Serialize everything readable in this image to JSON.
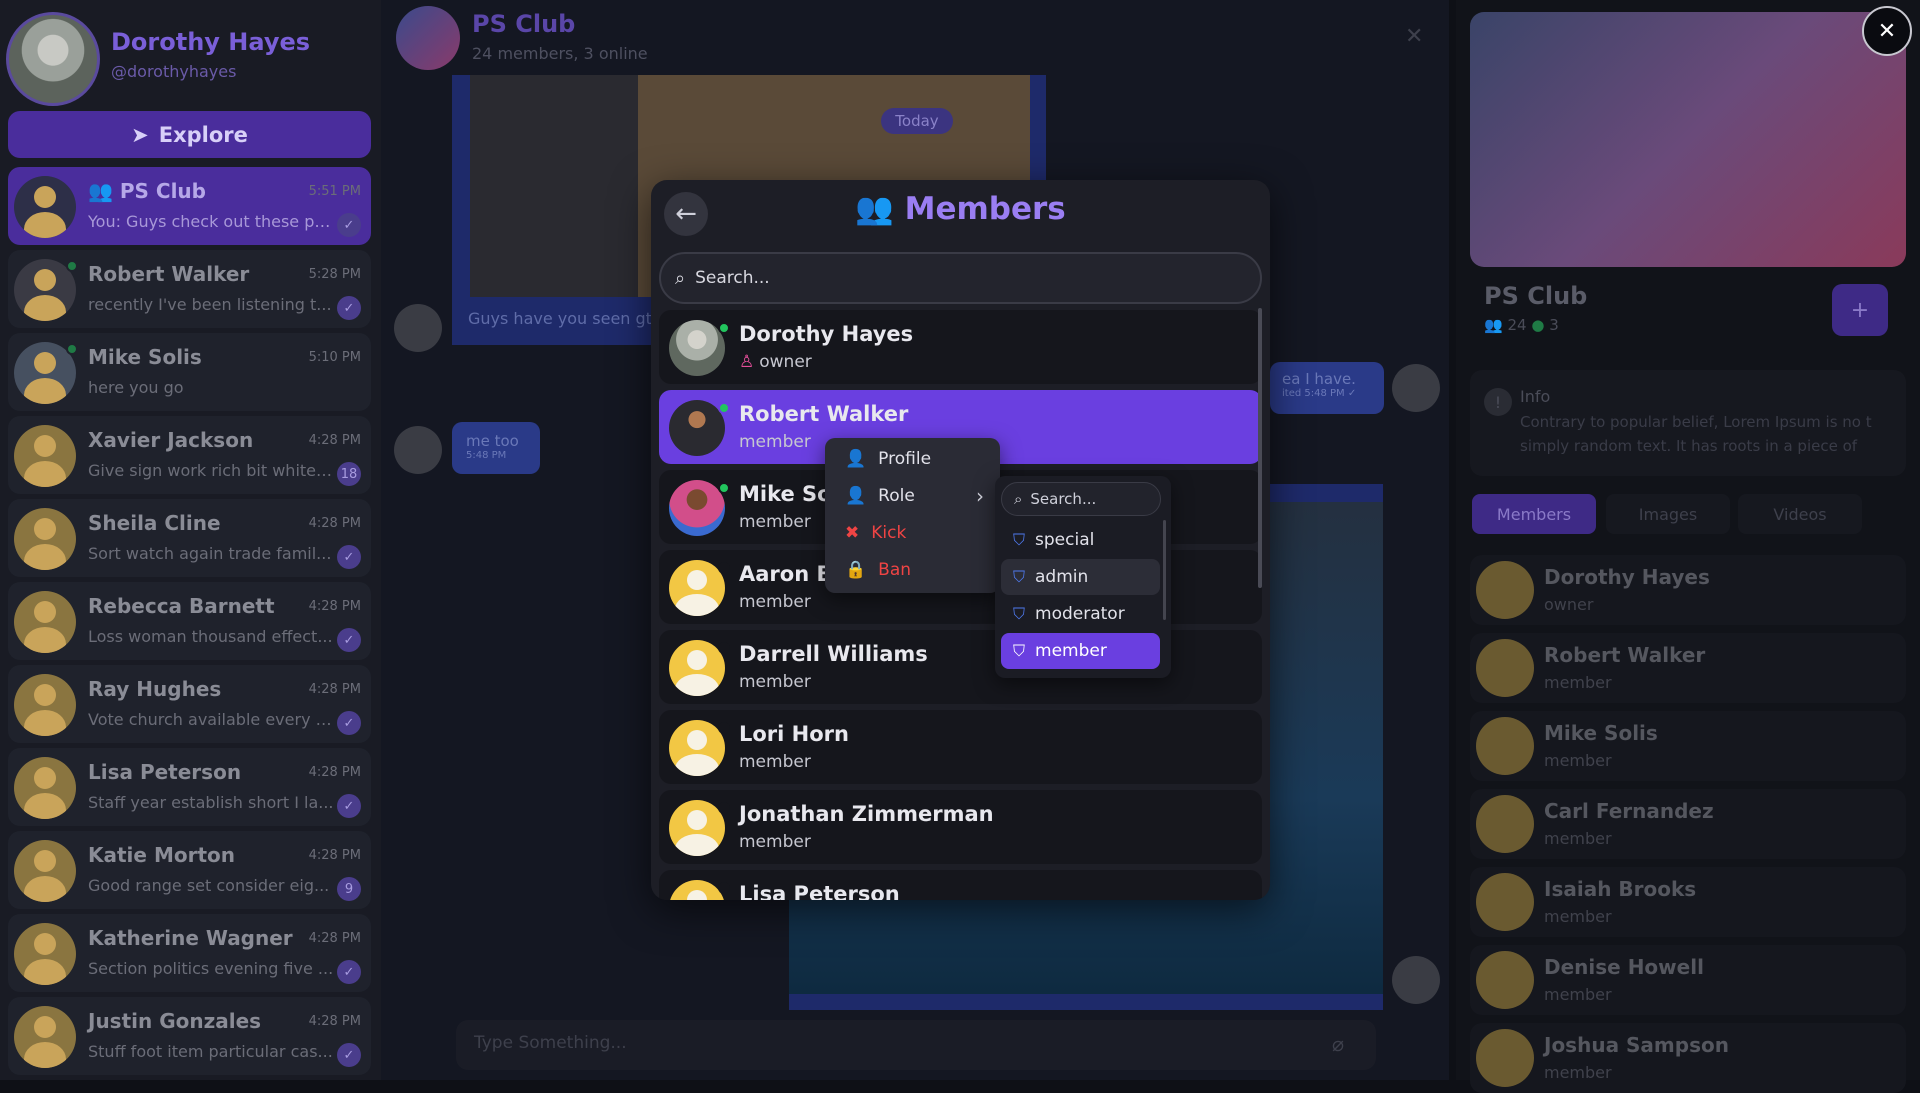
{
  "user": {
    "name": "Dorothy Hayes",
    "handle": "@dorothyhayes"
  },
  "explore_label": "Explore",
  "chats": [
    {
      "name": "PS Club",
      "time": "5:51 PM",
      "msg": "You: Guys check out these pc...",
      "badge": "✓",
      "group": true
    },
    {
      "name": "Robert Walker",
      "time": "5:28 PM",
      "msg": "recently I've been listening t...",
      "badge": "✓"
    },
    {
      "name": "Mike Solis",
      "time": "5:10 PM",
      "msg": "here you go",
      "badge": ""
    },
    {
      "name": "Xavier Jackson",
      "time": "4:28 PM",
      "msg": "Give sign work rich bit white ...",
      "badge": "18"
    },
    {
      "name": "Sheila Cline",
      "time": "4:28 PM",
      "msg": "Sort watch again trade famil...",
      "badge": "✓"
    },
    {
      "name": "Rebecca Barnett",
      "time": "4:28 PM",
      "msg": "Loss woman thousand effect...",
      "badge": "✓"
    },
    {
      "name": "Ray Hughes",
      "time": "4:28 PM",
      "msg": "Vote church available every t...",
      "badge": "✓"
    },
    {
      "name": "Lisa Peterson",
      "time": "4:28 PM",
      "msg": "Staff year establish short I la...",
      "badge": "✓"
    },
    {
      "name": "Katie Morton",
      "time": "4:28 PM",
      "msg": "Good range set consider eig...",
      "badge": "9"
    },
    {
      "name": "Katherine Wagner",
      "time": "4:28 PM",
      "msg": "Section politics evening five ...",
      "badge": "✓"
    },
    {
      "name": "Justin Gonzales",
      "time": "4:28 PM",
      "msg": "Stuff foot item particular cas...",
      "badge": "✓"
    }
  ],
  "channel": {
    "title": "PS Club",
    "subtitle": "24 members, 3 online",
    "today": "Today",
    "media_caption": "Guys have you seen gt",
    "me_too": "me too",
    "me_too_time": "5:48 PM",
    "i_have": "ea I have.",
    "i_have_time": "ited 5:48 PM ✓",
    "compose_placeholder": "Type Something..."
  },
  "group_panel": {
    "name": "PS Club",
    "members_count": "24",
    "online_count": "3",
    "info_title": "Info",
    "info_text": "Contrary to popular belief, Lorem Ipsum is no t simply random text. It has roots in a piece of",
    "tabs": [
      "Members",
      "Images",
      "Videos"
    ],
    "members": [
      {
        "name": "Dorothy Hayes",
        "role": "owner"
      },
      {
        "name": "Robert Walker",
        "role": "member"
      },
      {
        "name": "Mike Solis",
        "role": "member"
      },
      {
        "name": "Carl Fernandez",
        "role": "member"
      },
      {
        "name": "Isaiah Brooks",
        "role": "member"
      },
      {
        "name": "Denise Howell",
        "role": "member"
      },
      {
        "name": "Joshua Sampson",
        "role": "member"
      }
    ]
  },
  "modal": {
    "title": "Members",
    "search_placeholder": "Search...",
    "members": [
      {
        "name": "Dorothy Hayes",
        "role": "owner"
      },
      {
        "name": "Robert Walker",
        "role": "member"
      },
      {
        "name": "Mike Sol",
        "role": "member"
      },
      {
        "name": "Aaron Ba",
        "role": "member"
      },
      {
        "name": "Darrell Williams",
        "role": "member"
      },
      {
        "name": "Lori Horn",
        "role": "member"
      },
      {
        "name": "Jonathan Zimmerman",
        "role": "member"
      },
      {
        "name": "Lisa Peterson",
        "role": ""
      }
    ],
    "context_menu": {
      "profile": "Profile",
      "role": "Role",
      "kick": "Kick",
      "ban": "Ban"
    },
    "role_menu": {
      "search_placeholder": "Search...",
      "options": [
        "special",
        "admin",
        "moderator",
        "member"
      ],
      "hovered": "admin",
      "selected": "member"
    }
  },
  "colors": {
    "accent": "#6a3fe0",
    "danger": "#ef4444",
    "online": "#22c55e",
    "owner": "#e44e9a"
  }
}
